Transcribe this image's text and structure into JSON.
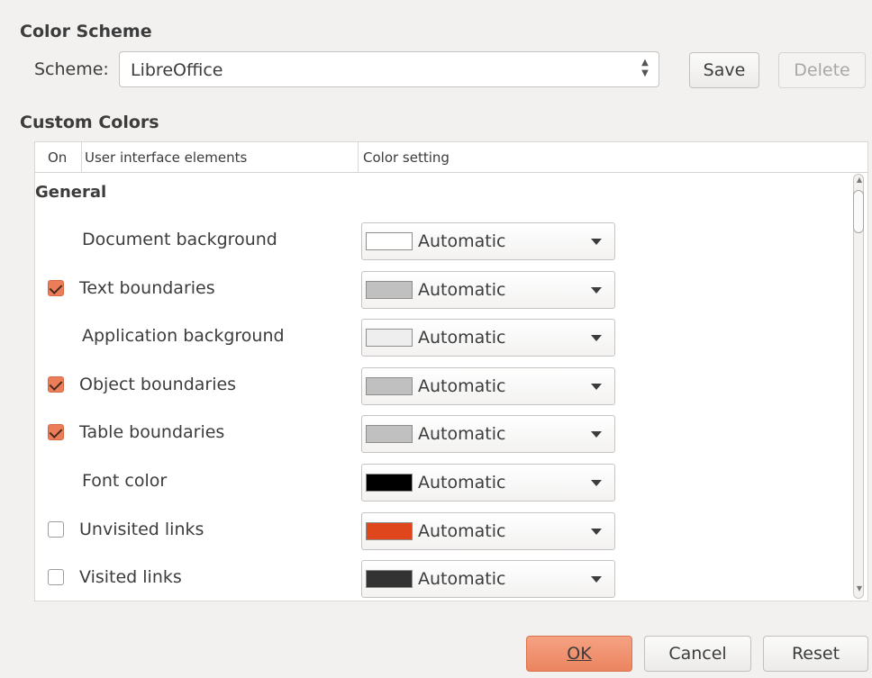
{
  "color_scheme": {
    "title": "Color Scheme",
    "scheme_label": "Scheme:",
    "scheme_value": "LibreOffice",
    "save_label": "Save",
    "delete_label": "Delete"
  },
  "custom_colors": {
    "title": "Custom Colors",
    "columns": [
      "On",
      "User interface elements",
      "Color setting"
    ],
    "group": "General",
    "rows": [
      {
        "label": "Document background",
        "checkbox": null,
        "color": "#ffffff",
        "value": "Automatic"
      },
      {
        "label": "Text boundaries",
        "checkbox": true,
        "color": "#c0c0c0",
        "value": "Automatic"
      },
      {
        "label": "Application background",
        "checkbox": null,
        "color": "#eeeeee",
        "value": "Automatic"
      },
      {
        "label": "Object boundaries",
        "checkbox": true,
        "color": "#c0c0c0",
        "value": "Automatic"
      },
      {
        "label": "Table boundaries",
        "checkbox": true,
        "color": "#c0c0c0",
        "value": "Automatic"
      },
      {
        "label": "Font color",
        "checkbox": null,
        "color": "#000000",
        "value": "Automatic"
      },
      {
        "label": "Unvisited links",
        "checkbox": false,
        "color": "#e0461c",
        "value": "Automatic"
      },
      {
        "label": "Visited links",
        "checkbox": false,
        "color": "#333333",
        "value": "Automatic"
      }
    ]
  },
  "footer": {
    "ok_label": "OK",
    "cancel_label": "Cancel",
    "reset_label": "Reset"
  },
  "colors": {
    "accent": "#eb7e58"
  }
}
